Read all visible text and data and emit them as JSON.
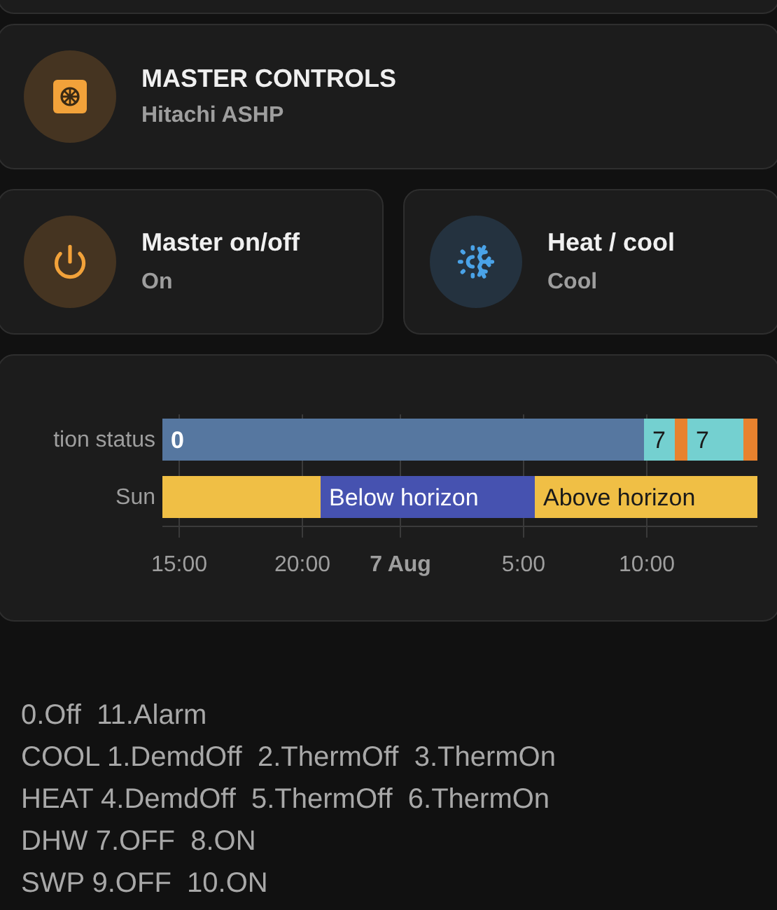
{
  "header_card": {
    "title": "MASTER CONTROLS",
    "subtitle": "Hitachi ASHP"
  },
  "tiles": [
    {
      "kind": "power",
      "name": "Master on/off",
      "state": "On"
    },
    {
      "kind": "heatcool",
      "name": "Heat / cool",
      "state": "Cool"
    }
  ],
  "history": {
    "rows": [
      {
        "label": "tion status",
        "segments": [
          {
            "text": "0",
            "color": "#5677a0"
          },
          {
            "text": "7",
            "color": "#74d0d0"
          },
          {
            "color": "#e8822e"
          },
          {
            "text": "7",
            "color": "#74d0d0"
          },
          {
            "color": "#e8822e"
          }
        ]
      },
      {
        "label": "Sun",
        "segments": [
          {
            "color": "#f0bf45"
          },
          {
            "text": "Below horizon",
            "color": "#4652b0"
          },
          {
            "text": "Above horizon",
            "color": "#f0bf45"
          }
        ]
      }
    ],
    "axis": [
      {
        "kind": "time",
        "label": "15:00"
      },
      {
        "kind": "time",
        "label": "20:00"
      },
      {
        "kind": "date",
        "label": "7 Aug"
      },
      {
        "kind": "time",
        "label": "5:00"
      },
      {
        "kind": "time",
        "label": "10:00"
      }
    ]
  },
  "legend": [
    "0.Off  11.Alarm",
    "COOL 1.DemdOff  2.ThermOff  3.ThermOn",
    "HEAT 4.DemdOff  5.ThermOff  6.ThermOn",
    "DHW 7.OFF  8.ON",
    "SWP 9.OFF  10.ON"
  ]
}
